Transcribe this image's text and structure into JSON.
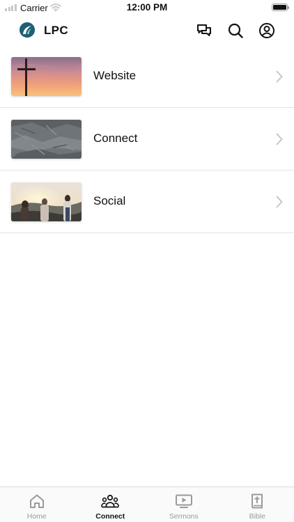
{
  "status_bar": {
    "carrier": "Carrier",
    "time": "12:00 PM"
  },
  "header": {
    "title": "LPC",
    "logo_icon": "lpc-logo-icon",
    "actions": [
      "chat-icon",
      "search-icon",
      "profile-icon"
    ]
  },
  "list": {
    "items": [
      {
        "label": "Website",
        "thumbnail": "cross-sunset-image",
        "chevron": "chevron-right-icon"
      },
      {
        "label": "Connect",
        "thumbnail": "stone-texture-image",
        "chevron": "chevron-right-icon"
      },
      {
        "label": "Social",
        "thumbnail": "people-hillside-image",
        "chevron": "chevron-right-icon"
      }
    ]
  },
  "tabbar": {
    "active": "Connect",
    "tabs": [
      {
        "label": "Home",
        "icon": "home-icon"
      },
      {
        "label": "Connect",
        "icon": "group-icon"
      },
      {
        "label": "Sermons",
        "icon": "video-play-icon"
      },
      {
        "label": "Bible",
        "icon": "bible-icon"
      }
    ]
  },
  "colors": {
    "brand": "#1f5f74",
    "active_tab": "#111111",
    "inactive_tab": "#9a9a9a",
    "divider": "#e4e4e4"
  }
}
